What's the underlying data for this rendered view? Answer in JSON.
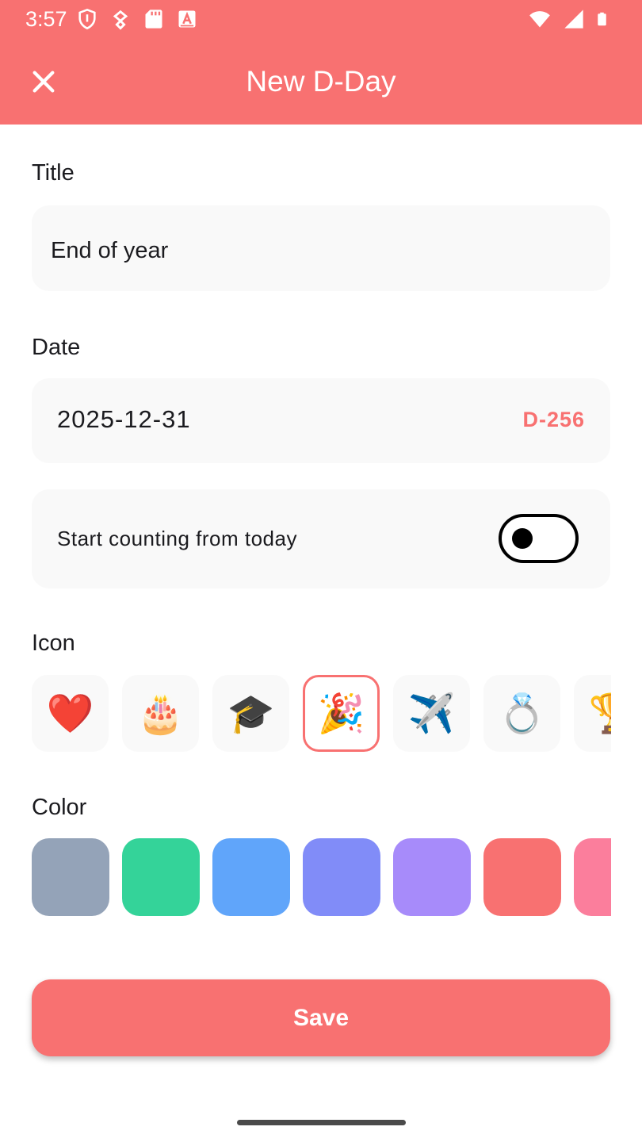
{
  "status_bar": {
    "time": "3:57",
    "left_icons": [
      "shield-icon",
      "vpn-key-icon",
      "sd-card-icon",
      "a-badge-icon"
    ],
    "right_icons": [
      "wifi-icon",
      "cell-signal-icon",
      "battery-icon"
    ]
  },
  "app_bar": {
    "title": "New D-Day",
    "close_icon": "close-icon"
  },
  "title_field": {
    "label": "Title",
    "value": "End of year"
  },
  "date_field": {
    "label": "Date",
    "value": "2025-12-31",
    "dday": "D-256"
  },
  "start_toggle": {
    "label": "Start counting from today",
    "checked": false
  },
  "icon_picker": {
    "label": "Icon",
    "items": [
      {
        "name": "heart-icon",
        "glyph": "❤️"
      },
      {
        "name": "cake-icon",
        "glyph": "🎂"
      },
      {
        "name": "graduation-cap-icon",
        "glyph": "🎓"
      },
      {
        "name": "party-popper-icon",
        "glyph": "🎉"
      },
      {
        "name": "airplane-icon",
        "glyph": "✈️"
      },
      {
        "name": "ring-icon",
        "glyph": "💍"
      },
      {
        "name": "trophy-icon",
        "glyph": "🏆"
      }
    ],
    "selected_index": 3
  },
  "color_picker": {
    "label": "Color",
    "colors": [
      "#94A3B8",
      "#34D399",
      "#60A5FA",
      "#818CF8",
      "#A78BFA",
      "#F87171",
      "#FB7E9C"
    ]
  },
  "save_button": {
    "label": "Save"
  },
  "theme": {
    "accent": "#F87171"
  }
}
